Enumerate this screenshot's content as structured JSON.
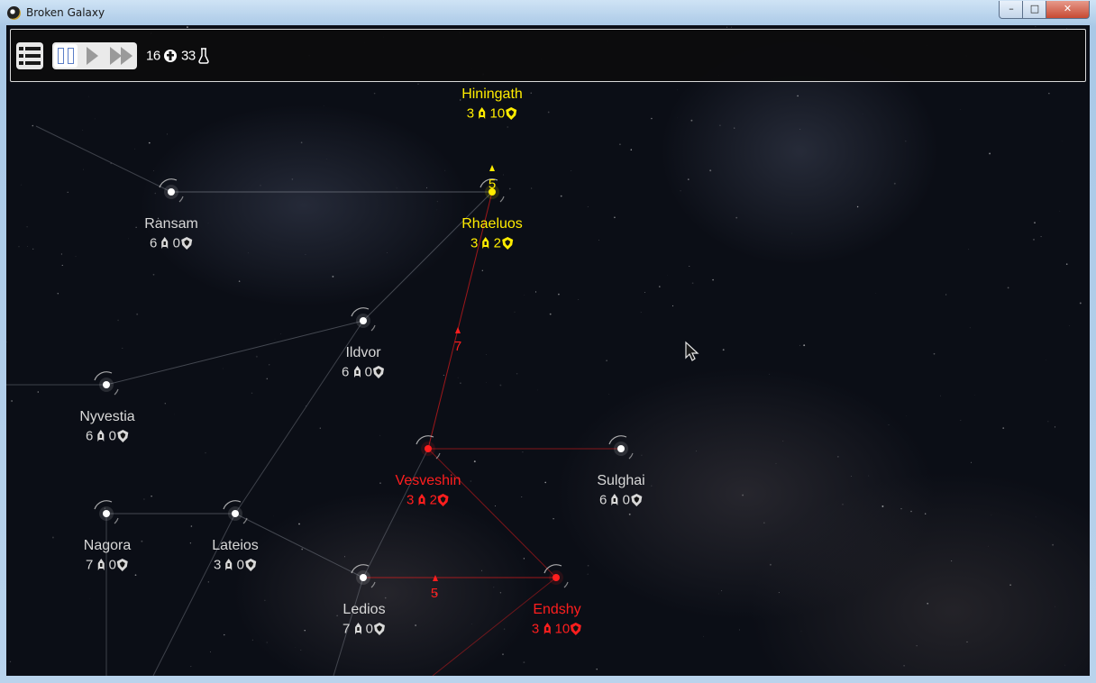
{
  "window": {
    "title": "Broken Galaxy",
    "controls": {
      "minimize": "–",
      "maximize": "□",
      "close": "✕"
    }
  },
  "toolbar": {
    "menu_icon": "list-menu-icon",
    "speed_controls": [
      "pause-icon",
      "play-icon",
      "fast-forward-icon"
    ],
    "population": "16",
    "research": "33",
    "population_icon": "population-icon",
    "research_icon": "flask-icon"
  },
  "colors": {
    "neutral": "#d8d8d8",
    "yellow_faction": "#ffec00",
    "red_faction": "#ff1e1e",
    "lane": "#8a8f99"
  },
  "planets": [
    {
      "id": "hiningath",
      "name": "Hiningath",
      "ships": "3",
      "defense": "10",
      "owner": "yellow"
    },
    {
      "id": "ransam",
      "name": "Ransam",
      "ships": "6",
      "defense": "0",
      "owner": "neutral"
    },
    {
      "id": "rhaeluos",
      "name": "Rhaeluos",
      "ships": "3",
      "defense": "2",
      "owner": "yellow"
    },
    {
      "id": "ildvor",
      "name": "Ildvor",
      "ships": "6",
      "defense": "0",
      "owner": "neutral"
    },
    {
      "id": "nyvestia",
      "name": "Nyvestia",
      "ships": "6",
      "defense": "0",
      "owner": "neutral"
    },
    {
      "id": "vesveshin",
      "name": "Vesveshin",
      "ships": "3",
      "defense": "2",
      "owner": "red"
    },
    {
      "id": "sulghai",
      "name": "Sulghai",
      "ships": "6",
      "defense": "0",
      "owner": "neutral"
    },
    {
      "id": "nagora",
      "name": "Nagora",
      "ships": "7",
      "defense": "0",
      "owner": "neutral"
    },
    {
      "id": "lateios",
      "name": "Lateios",
      "ships": "3",
      "defense": "0",
      "owner": "neutral"
    },
    {
      "id": "ledios",
      "name": "Ledios",
      "ships": "7",
      "defense": "0",
      "owner": "neutral"
    },
    {
      "id": "endshy",
      "name": "Endshy",
      "ships": "3",
      "defense": "10",
      "owner": "red"
    }
  ],
  "fleets": [
    {
      "id": "fleet-yellow",
      "count": "5",
      "owner": "yellow"
    },
    {
      "id": "fleet-red-north",
      "count": "7",
      "owner": "red"
    },
    {
      "id": "fleet-red-south",
      "count": "5",
      "owner": "red"
    }
  ]
}
